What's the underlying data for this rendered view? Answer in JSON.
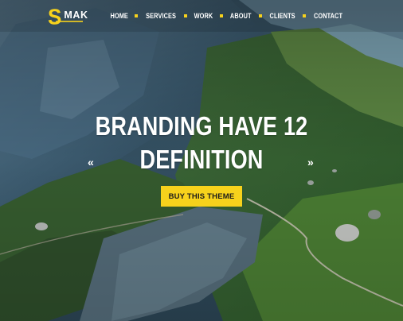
{
  "brand": {
    "logo_letter": "S",
    "logo_text": "MAK",
    "accent_color": "#f7d21c"
  },
  "nav": {
    "items": [
      "HOME",
      "SERVICES",
      "WORK",
      "ABOUT",
      "CLIENTS",
      "CONTACT"
    ]
  },
  "hero": {
    "title_line1": "BRANDING HAVE 12",
    "title_line2": "DEFINITION",
    "cta_label": "BUY THIS THEME",
    "prev_arrow": "«",
    "next_arrow": "»"
  },
  "icons": {
    "prev": "chevron-double-left-icon",
    "next": "chevron-double-right-icon"
  }
}
